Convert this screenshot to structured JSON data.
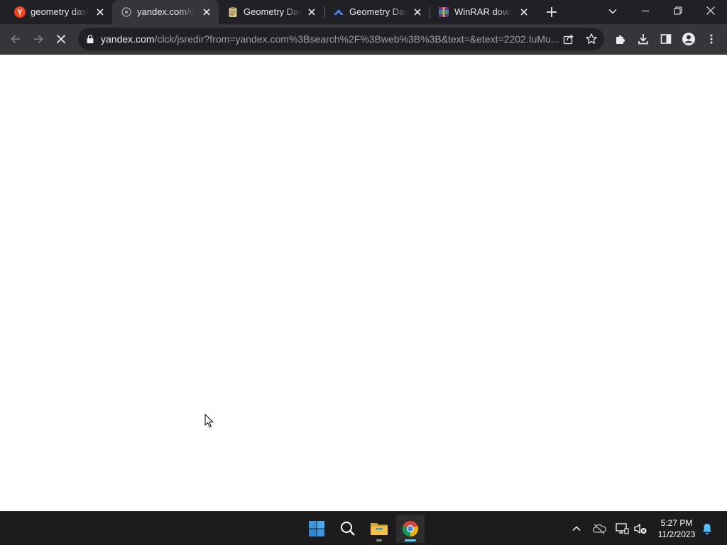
{
  "browser": {
    "tabs": [
      {
        "title": "geometry dash",
        "favicon": "yandex-icon",
        "active": false
      },
      {
        "title": "yandex.com/clck",
        "favicon": "loading-globe-icon",
        "active": true
      },
      {
        "title": "Geometry Dash",
        "favicon": "clipboard-icon",
        "active": false
      },
      {
        "title": "Geometry Dash",
        "favicon": "cloud-icon",
        "active": false
      },
      {
        "title": "WinRAR download",
        "favicon": "winrar-icon",
        "active": false
      }
    ],
    "url": {
      "host": "yandex.com",
      "path": "/clck/jsredir?from=yandex.com%3Bsearch%2F%3Bweb%3B%3B&text=&etext=2202.IuMu..."
    },
    "loading": true
  },
  "taskbar": {
    "apps": [
      "windows-start-icon",
      "search-icon",
      "file-explorer-icon",
      "chrome-icon"
    ],
    "active_app": "chrome-icon",
    "tray": [
      "chevron-up-icon",
      "onedrive-icon",
      "network-icon",
      "volume-muted-icon",
      "notification-bell-icon"
    ],
    "time": "5:27 PM",
    "date": "11/2/2023"
  },
  "colors": {
    "tabstrip_bg": "#202124",
    "toolbar_bg": "#35363a",
    "omnibox_bg": "#202124",
    "page_bg": "#ffffff",
    "taskbar_bg": "#1c1c1c",
    "windows_blue": "#3a96dd",
    "folder_yellow": "#f4c242"
  }
}
